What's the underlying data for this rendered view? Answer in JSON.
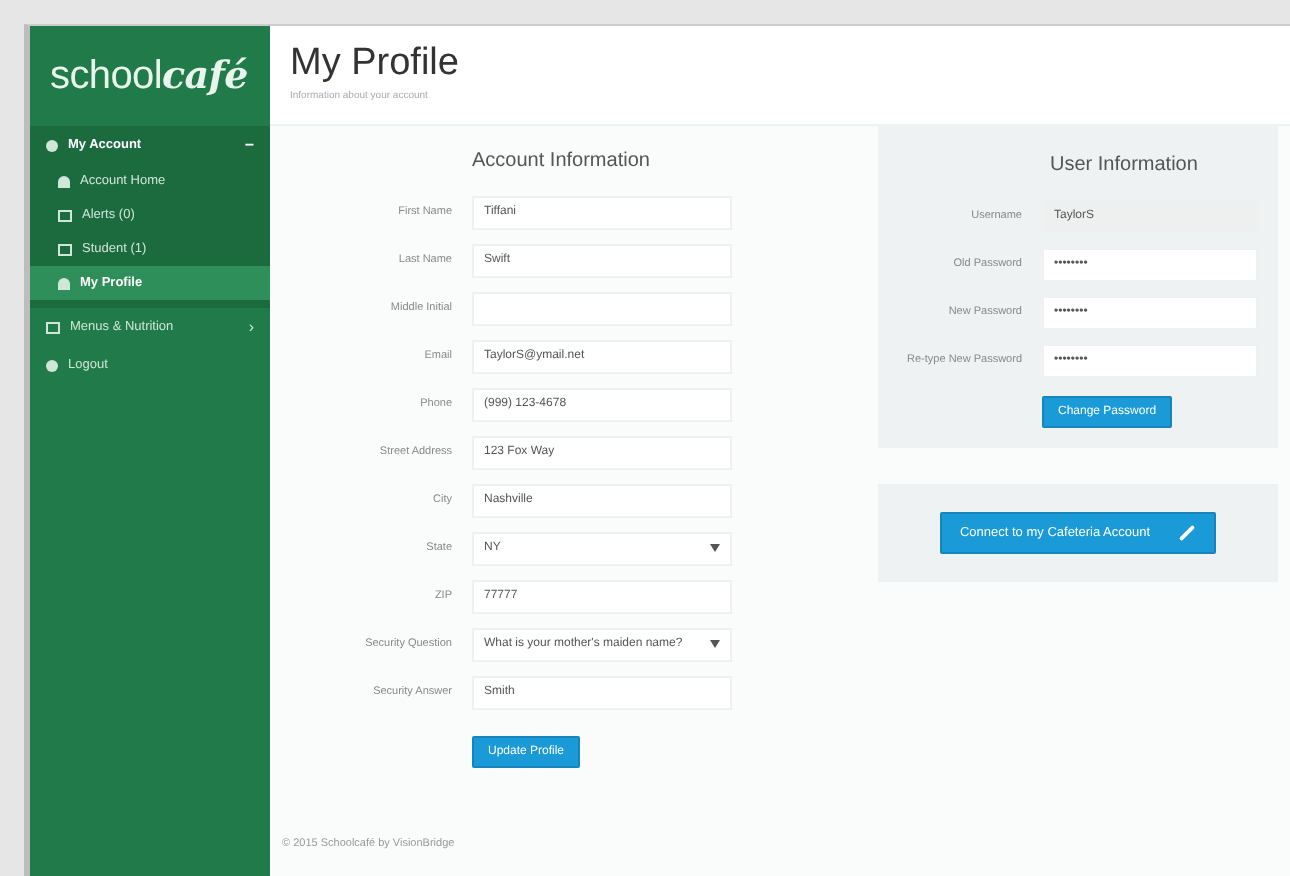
{
  "logo": {
    "plain": "school",
    "accent": "café"
  },
  "sidebar": {
    "items": [
      {
        "label": "My Account",
        "selected": false,
        "expanded": true,
        "caret": "−",
        "children": [
          {
            "label": "Account Home",
            "selected": false
          },
          {
            "label": "Alerts (0)",
            "selected": false
          },
          {
            "label": "Student (1)",
            "selected": false
          },
          {
            "label": "My Profile",
            "selected": true
          }
        ]
      },
      {
        "label": "Menus & Nutrition",
        "selected": false,
        "expanded": false,
        "caret": "›"
      },
      {
        "label": "Logout",
        "selected": false
      }
    ]
  },
  "header": {
    "title": "My Profile",
    "subtitle": "Information about your account"
  },
  "account": {
    "heading": "Account Information",
    "fields": [
      {
        "label": "First Name",
        "kind": "input",
        "value": "Tiffani"
      },
      {
        "label": "Last Name",
        "kind": "input",
        "value": "Swift"
      },
      {
        "label": "Middle Initial",
        "kind": "input"
      },
      {
        "label": "Email",
        "kind": "input",
        "value": "TaylorS@ymail.net"
      },
      {
        "label": "Phone",
        "kind": "input",
        "value": "(999) 123-4678"
      },
      {
        "label": "Street Address",
        "kind": "input",
        "value": "123 Fox Way"
      },
      {
        "label": "City",
        "kind": "input",
        "value": "Nashville"
      },
      {
        "label": "State",
        "kind": "select",
        "value": "NY"
      },
      {
        "label": "ZIP",
        "kind": "input",
        "value": "77777"
      },
      {
        "label": "Security Question",
        "kind": "select",
        "value": "What is your mother's maiden name?"
      },
      {
        "label": "Security Answer",
        "kind": "input",
        "value": "Smith"
      }
    ],
    "button": "Update Profile"
  },
  "user": {
    "heading": "User Information",
    "fields": [
      {
        "label": "Username",
        "kind": "readonly",
        "value": "TaylorS"
      },
      {
        "label": "Old Password",
        "kind": "password",
        "value": "••••••••"
      },
      {
        "label": "New Password",
        "kind": "password",
        "value": "••••••••"
      },
      {
        "label": "Re-type New Password",
        "kind": "password",
        "value": "••••••••"
      }
    ],
    "button": "Change Password"
  },
  "connect": {
    "button": "Connect to my Cafeteria Account"
  },
  "footer": "© 2015 Schoolcafé by VisionBridge"
}
